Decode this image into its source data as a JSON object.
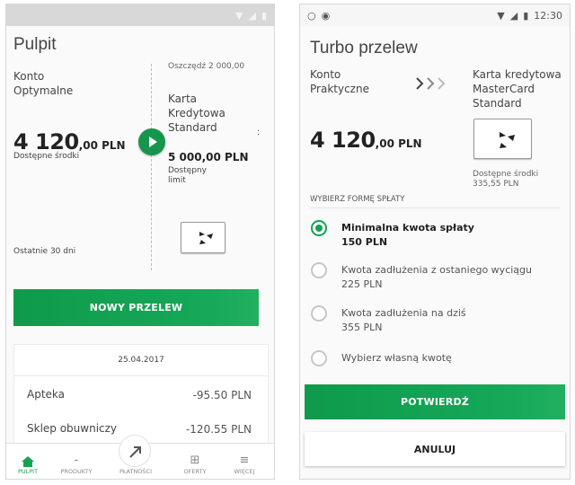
{
  "left": {
    "title": "Pulpit",
    "account_name_line1": "Konto",
    "account_name_line2": "Optymalne",
    "balance_int": "4 120",
    "balance_dec": ",00 PLN",
    "balance_label": "Dostępne środki",
    "period_label": "Ostatnie 30 dni",
    "card_savings_text": "Oszczędź 2 000,00 PLN",
    "card_name_line1": "Karta",
    "card_name_line2": "Kredytowa",
    "card_name_line3": "Standard",
    "card_limit_amount": "5 000,00 PLN",
    "card_limit_line1": "Dostępny",
    "card_limit_line2": "limit",
    "new_transfer_button": "NOWY PRZELEW",
    "history_date": "25.04.2017",
    "transactions": [
      {
        "name": "Apteka",
        "amount": "-95.50 PLN"
      },
      {
        "name": "Sklep obuwniczy",
        "amount": "-120.55 PLN"
      }
    ],
    "nav": [
      {
        "label": "PULPIT",
        "icon": "home-icon"
      },
      {
        "label": "PRODUKTY",
        "icon": "products-icon"
      },
      {
        "label": "PŁATNOŚCI",
        "icon": "payments-arrow-icon"
      },
      {
        "label": "OFERTY",
        "icon": "basket-icon"
      },
      {
        "label": "WIĘCEJ",
        "icon": "menu-icon"
      }
    ],
    "colors": {
      "accent": "#16a253",
      "statusbar": "#d8d8d8"
    }
  },
  "right": {
    "time": "12:30",
    "title": "Turbo przelew",
    "from_line1": "Konto",
    "from_line2": "Praktyczne",
    "to_line1": "Karta kredytowa",
    "to_line2": "MasterCard",
    "to_line3": "Standard",
    "balance_int": "4 120",
    "balance_dec": ",00 PLN",
    "card_available_label": "Dostępne środki",
    "card_available_amount": "335,55 PLN",
    "section_header": "WYBIERZ FORMĘ SPŁATY",
    "options": [
      {
        "label": "Minimalna kwota spłaty",
        "amount": "150 PLN",
        "selected": true
      },
      {
        "label": "Kwota zadłużenia z ostaniego wyciągu",
        "amount": "225 PLN",
        "selected": false
      },
      {
        "label": "Kwota zadłużenia na dziś",
        "amount": "355 PLN",
        "selected": false
      },
      {
        "label": "Wybierz własną kwotę",
        "amount": "",
        "selected": false
      }
    ],
    "confirm_button": "POTWIERDŹ",
    "cancel_button": "ANULUJ",
    "colors": {
      "accent": "#16a253"
    }
  }
}
